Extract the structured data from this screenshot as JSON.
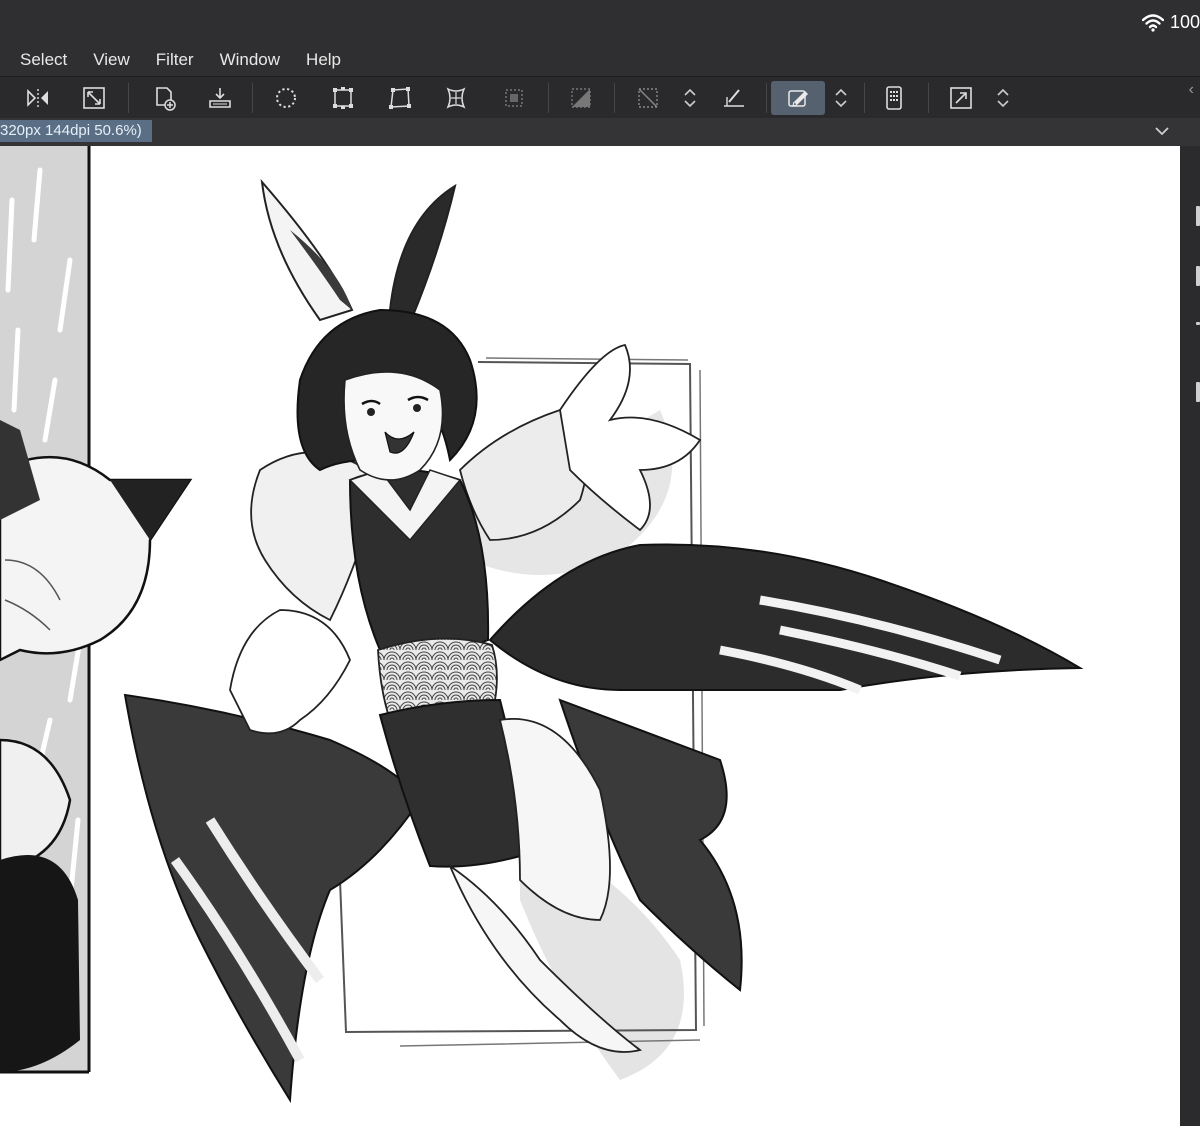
{
  "status": {
    "battery": "100"
  },
  "menu": {
    "items": [
      {
        "label": "Select"
      },
      {
        "label": "View"
      },
      {
        "label": "Filter"
      },
      {
        "label": "Window"
      },
      {
        "label": "Help"
      }
    ]
  },
  "document": {
    "tab_label": "320px 144dpi 50.6%)"
  },
  "colors": {
    "accent": "#5a6f86",
    "toolbar_active": "#55616e",
    "background": "#2b2b2d"
  },
  "toolbar": {
    "icons": [
      "flip-horizontal-icon",
      "fit-canvas-icon",
      "new-layer-icon",
      "import-icon",
      "lasso-icon",
      "transform-icon",
      "distort-icon",
      "mesh-icon",
      "select-layer-icon",
      "tone-icon",
      "deselect-icon",
      "chevron-updown-icon",
      "ruler-icon",
      "eraser-pen-icon",
      "chevron-updown-icon",
      "device-icon",
      "expand-icon",
      "chevron-updown-icon"
    ]
  }
}
